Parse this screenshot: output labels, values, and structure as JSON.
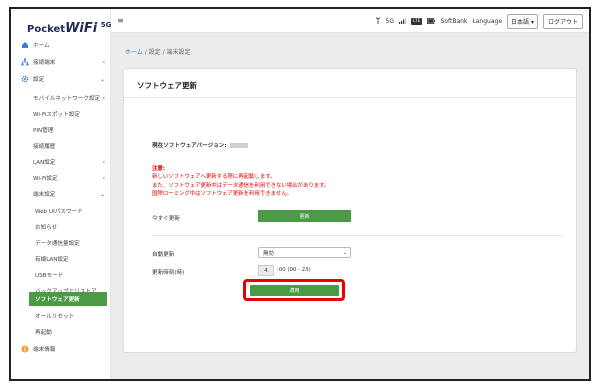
{
  "logo": {
    "pre": "Pocket",
    "main": "WiFi",
    "suffix": "5G"
  },
  "topbar": {
    "menu_icon": "hamburger-icon",
    "signal_text": "5G",
    "network_badge": "LTE",
    "carrier": "SoftBank",
    "language_label": "Language",
    "language_value": "日本語",
    "logout_label": "ログアウト"
  },
  "sidebar": {
    "items": [
      {
        "label": "ホーム",
        "icon": "home-icon"
      },
      {
        "label": "接続端末",
        "icon": "network-icon",
        "chevron": "‹"
      },
      {
        "label": "設定",
        "icon": "gear-icon",
        "chevron": "⌄"
      },
      {
        "label": "モバイルネットワーク設定",
        "chevron": "‹"
      },
      {
        "label": "Wi-Fiスポット設定"
      },
      {
        "label": "PIN管理"
      },
      {
        "label": "接続履歴"
      },
      {
        "label": "LAN設定",
        "chevron": "‹"
      },
      {
        "label": "Wi-Fi設定",
        "chevron": "‹"
      },
      {
        "label": "端末設定",
        "chevron": "⌄"
      },
      {
        "label": "Web UIパスワード"
      },
      {
        "label": "お知らせ"
      },
      {
        "label": "データ通信量設定"
      },
      {
        "label": "有線LAN設定"
      },
      {
        "label": "USBモード"
      },
      {
        "label": "バックアップとリストア"
      },
      {
        "label": "ソフトウェア更新"
      },
      {
        "label": "オールリセット"
      },
      {
        "label": "再起動"
      },
      {
        "label": "端末情報",
        "icon": "info-icon"
      }
    ]
  },
  "breadcrumb": {
    "home": "ホーム",
    "sep": " / ",
    "level1": "設定",
    "level2": "端末設定"
  },
  "card": {
    "title": "ソフトウェア更新",
    "current_version_label": "現在ソフトウェアバージョン:",
    "notice_lines": [
      "注意:",
      "新しいソフトウェアへ更新する際に再起動します。",
      "また、ソフトウェア更新中はデータ通信を利用できない場合があります。",
      "国際ローミング中はソフトウェア更新を利用できません。"
    ],
    "update_now_label": "今すぐ更新",
    "update_now_button": "更新",
    "auto_update_label": "自動更新",
    "auto_update_value": "無効",
    "update_time_label": "更新時刻(時)",
    "update_hour_value": "4",
    "update_hour_suffix": ":00 (00 - 23)",
    "apply_button": "適用"
  },
  "colors": {
    "accent_green": "#4a9a46",
    "notice_red": "#e00000",
    "highlight": "#e60000",
    "link": "#3a7bd5"
  }
}
